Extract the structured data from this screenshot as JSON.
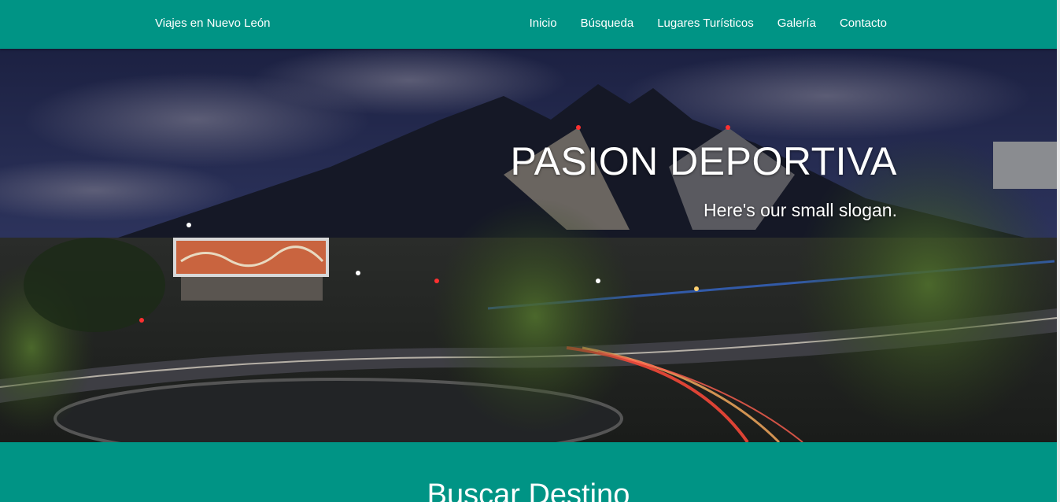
{
  "colors": {
    "primary": "#009485",
    "text_on_primary": "#ffffff"
  },
  "navbar": {
    "brand": "Viajes en Nuevo León",
    "items": [
      {
        "label": "Inicio"
      },
      {
        "label": "Búsqueda"
      },
      {
        "label": "Lugares Turísticos"
      },
      {
        "label": "Galería"
      },
      {
        "label": "Contacto"
      }
    ]
  },
  "hero": {
    "title": "PASION DEPORTIVA",
    "slogan": "Here's our small slogan.",
    "image_description_icon": "city-night-landscape-image"
  },
  "search_section": {
    "title": "Buscar Destino"
  }
}
